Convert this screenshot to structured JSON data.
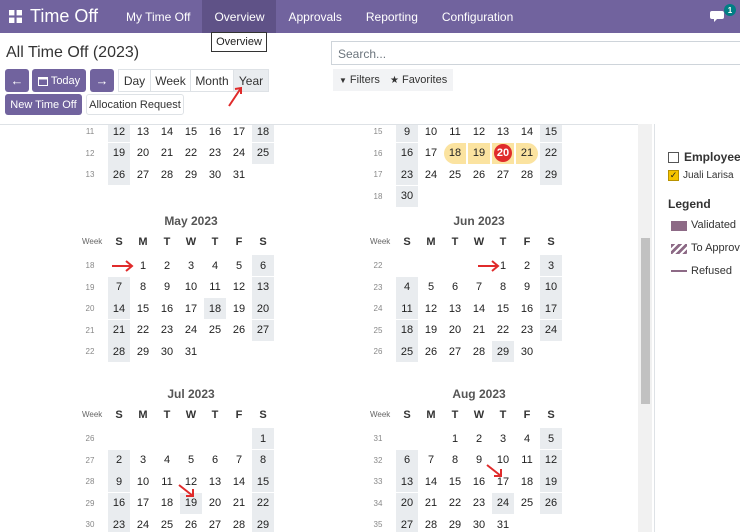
{
  "navbar": {
    "app_title": "Time Off",
    "items": [
      "My Time Off",
      "Overview",
      "Approvals",
      "Reporting",
      "Configuration"
    ],
    "active_index": 1,
    "chat_badge": "1",
    "accent_color": "#71639e"
  },
  "tooltip": "Overview",
  "page_title": "All Time Off (2023)",
  "search": {
    "placeholder": "Search..."
  },
  "filters": {
    "filters_label": "Filters",
    "favorites_label": "Favorites"
  },
  "toolbar": {
    "today_label": "Today",
    "scales": [
      "Day",
      "Week",
      "Month",
      "Year"
    ],
    "active_scale": "Year",
    "new_label": "New Time Off",
    "allocation_label": "Allocation Request"
  },
  "side": {
    "employee_heading": "Employee",
    "employee_name": "Juali Larisa",
    "legend_heading": "Legend",
    "legend": [
      {
        "label": "Validated",
        "color": "#8d6a86",
        "style": "solid"
      },
      {
        "label": "To Approve",
        "color": "#8d6a86",
        "style": "striped"
      },
      {
        "label": "Refused",
        "color": "#8d6a86",
        "style": "line"
      }
    ]
  },
  "calendar": {
    "week_header": "Week",
    "dow": [
      "S",
      "M",
      "T",
      "W",
      "T",
      "F",
      "S"
    ],
    "months": [
      {
        "title": "",
        "weeks": [
          {
            "wk": "11",
            "days": [
              "12",
              "13",
              "14",
              "15",
              "16",
              "17",
              "18"
            ]
          },
          {
            "wk": "12",
            "days": [
              "19",
              "20",
              "21",
              "22",
              "23",
              "24",
              "25"
            ]
          },
          {
            "wk": "13",
            "days": [
              "26",
              "27",
              "28",
              "29",
              "30",
              "31",
              ""
            ]
          }
        ]
      },
      {
        "title": "",
        "weeks": [
          {
            "wk": "15",
            "days": [
              "9",
              "10",
              "11",
              "12",
              "13",
              "14",
              "15"
            ]
          },
          {
            "wk": "16",
            "days": [
              "16",
              "17",
              "18",
              "19",
              "20",
              "21",
              "22"
            ]
          },
          {
            "wk": "17",
            "days": [
              "23",
              "24",
              "25",
              "26",
              "27",
              "28",
              "29"
            ]
          },
          {
            "wk": "18",
            "days": [
              "30",
              "",
              "",
              "",
              "",
              "",
              ""
            ]
          }
        ]
      },
      {
        "title": "May 2023",
        "weeks": [
          {
            "wk": "18",
            "days": [
              "",
              "1",
              "2",
              "3",
              "4",
              "5",
              "6"
            ]
          },
          {
            "wk": "19",
            "days": [
              "7",
              "8",
              "9",
              "10",
              "11",
              "12",
              "13"
            ]
          },
          {
            "wk": "20",
            "days": [
              "14",
              "15",
              "16",
              "17",
              "18",
              "19",
              "20"
            ]
          },
          {
            "wk": "21",
            "days": [
              "21",
              "22",
              "23",
              "24",
              "25",
              "26",
              "27"
            ]
          },
          {
            "wk": "22",
            "days": [
              "28",
              "29",
              "30",
              "31",
              "",
              "",
              ""
            ]
          }
        ]
      },
      {
        "title": "Jun 2023",
        "weeks": [
          {
            "wk": "22",
            "days": [
              "",
              "",
              "",
              "",
              "1",
              "2",
              "3"
            ]
          },
          {
            "wk": "23",
            "days": [
              "4",
              "5",
              "6",
              "7",
              "8",
              "9",
              "10"
            ]
          },
          {
            "wk": "24",
            "days": [
              "11",
              "12",
              "13",
              "14",
              "15",
              "16",
              "17"
            ]
          },
          {
            "wk": "25",
            "days": [
              "18",
              "19",
              "20",
              "21",
              "22",
              "23",
              "24"
            ]
          },
          {
            "wk": "26",
            "days": [
              "25",
              "26",
              "27",
              "28",
              "29",
              "30",
              ""
            ]
          }
        ]
      },
      {
        "title": "Jul 2023",
        "weeks": [
          {
            "wk": "26",
            "days": [
              "",
              "",
              "",
              "",
              "",
              "",
              "1"
            ]
          },
          {
            "wk": "27",
            "days": [
              "2",
              "3",
              "4",
              "5",
              "6",
              "7",
              "8"
            ]
          },
          {
            "wk": "28",
            "days": [
              "9",
              "10",
              "11",
              "12",
              "13",
              "14",
              "15"
            ]
          },
          {
            "wk": "29",
            "days": [
              "16",
              "17",
              "18",
              "19",
              "20",
              "21",
              "22"
            ]
          },
          {
            "wk": "30",
            "days": [
              "23",
              "24",
              "25",
              "26",
              "27",
              "28",
              "29"
            ]
          }
        ]
      },
      {
        "title": "Aug 2023",
        "weeks": [
          {
            "wk": "31",
            "days": [
              "",
              "",
              "1",
              "2",
              "3",
              "4",
              "5"
            ]
          },
          {
            "wk": "32",
            "days": [
              "6",
              "7",
              "8",
              "9",
              "10",
              "11",
              "12"
            ]
          },
          {
            "wk": "33",
            "days": [
              "13",
              "14",
              "15",
              "16",
              "17",
              "18",
              "19"
            ]
          },
          {
            "wk": "34",
            "days": [
              "20",
              "21",
              "22",
              "23",
              "24",
              "25",
              "26"
            ]
          },
          {
            "wk": "35",
            "days": [
              "27",
              "28",
              "29",
              "30",
              "31",
              "",
              ""
            ]
          }
        ]
      }
    ],
    "highlighted": [
      {
        "month_index": 1,
        "week_index": 1,
        "day_indexes": [
          2,
          3,
          4,
          5
        ],
        "today_day_index": 4
      },
      {
        "month_index": 2,
        "weekday_extra": [
          [
            2,
            4
          ]
        ]
      },
      {
        "month_index": 3,
        "weekday_extra": [
          [
            4,
            4
          ]
        ]
      },
      {
        "month_index": 4,
        "weekday_extra": [
          [
            3,
            3
          ]
        ]
      },
      {
        "month_index": 5,
        "weekday_extra": [
          [
            3,
            4
          ]
        ]
      }
    ]
  }
}
